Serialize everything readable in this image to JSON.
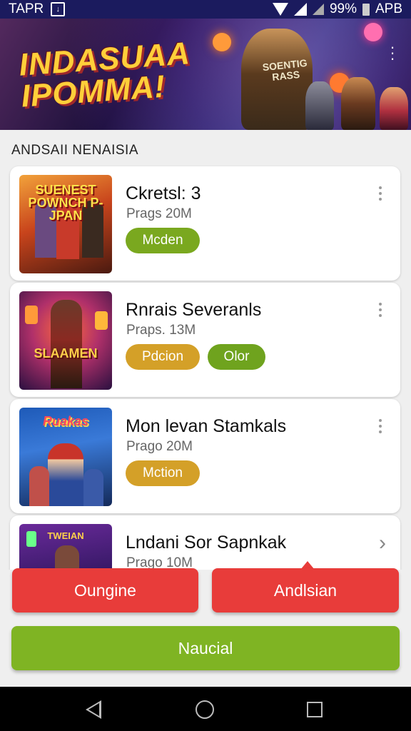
{
  "status_bar": {
    "carrier": "TAPR",
    "battery": "99%",
    "right_label": "APB"
  },
  "banner": {
    "title": "INDASUAA IPOMMA!",
    "hero_text": "SOENTIG RASS"
  },
  "section": {
    "title": "ANDSAII NENAISIA"
  },
  "games": [
    {
      "title": "Ckretsl: 3",
      "subtitle": "Prags 20M",
      "thumb_text": "SUENEST POWNCH P-JPAN",
      "tags": [
        {
          "label": "Mcden",
          "color": "#7aa81f"
        }
      ]
    },
    {
      "title": "Rnrais Severanls",
      "subtitle": "Praps. 13M",
      "thumb_text": "SLAAMEN",
      "tags": [
        {
          "label": "Pdcion",
          "color": "#d4a028"
        },
        {
          "label": "Olor",
          "color": "#6fa31e"
        }
      ]
    },
    {
      "title": "Mon levan Stamkals",
      "subtitle": "Prago 20M",
      "thumb_text": "Ruakas",
      "tags": [
        {
          "label": "Mction",
          "color": "#d4a028"
        }
      ]
    },
    {
      "title": "Lndani Sor Sapnkak",
      "subtitle": "Prago 10M",
      "thumb_text": "TWEIAN",
      "tags": []
    }
  ],
  "buttons": {
    "left": "Oungine",
    "right": "Andlsian",
    "primary": "Naucial"
  },
  "colors": {
    "red": "#e83c3a",
    "green": "#7fb423",
    "status_bar": "#1b1b5e"
  }
}
